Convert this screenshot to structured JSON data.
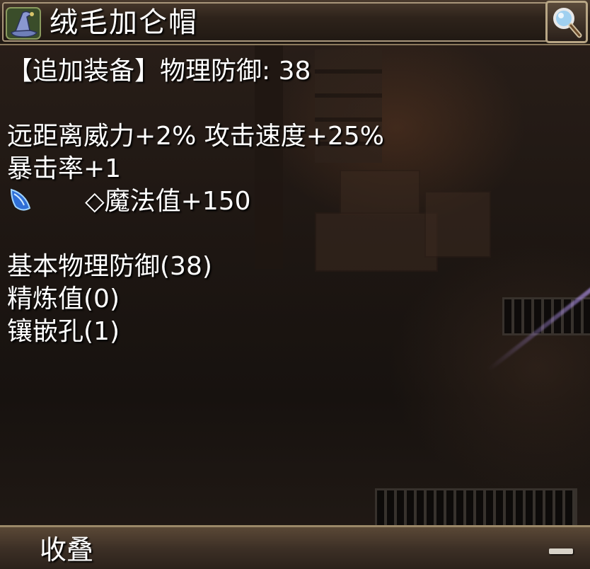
{
  "item": {
    "name": "绒毛加仑帽",
    "icon": "wizard-hat-icon"
  },
  "header": {
    "search_icon": "magnifier-icon"
  },
  "stats": {
    "additional_equip": "【追加装备】物理防御: 38",
    "line1": "远距离威力+2% 攻击速度+25%",
    "line2": "暴击率+1",
    "gem_stat": "◇魔法值+150",
    "gem_icon": "blue-gem-icon",
    "base_defense": "基本物理防御(38)",
    "refine": "精炼值(0)",
    "sockets": "镶嵌孔(1)"
  },
  "footer": {
    "collapse_label": "收叠",
    "collapse_icon": "minus-icon"
  }
}
